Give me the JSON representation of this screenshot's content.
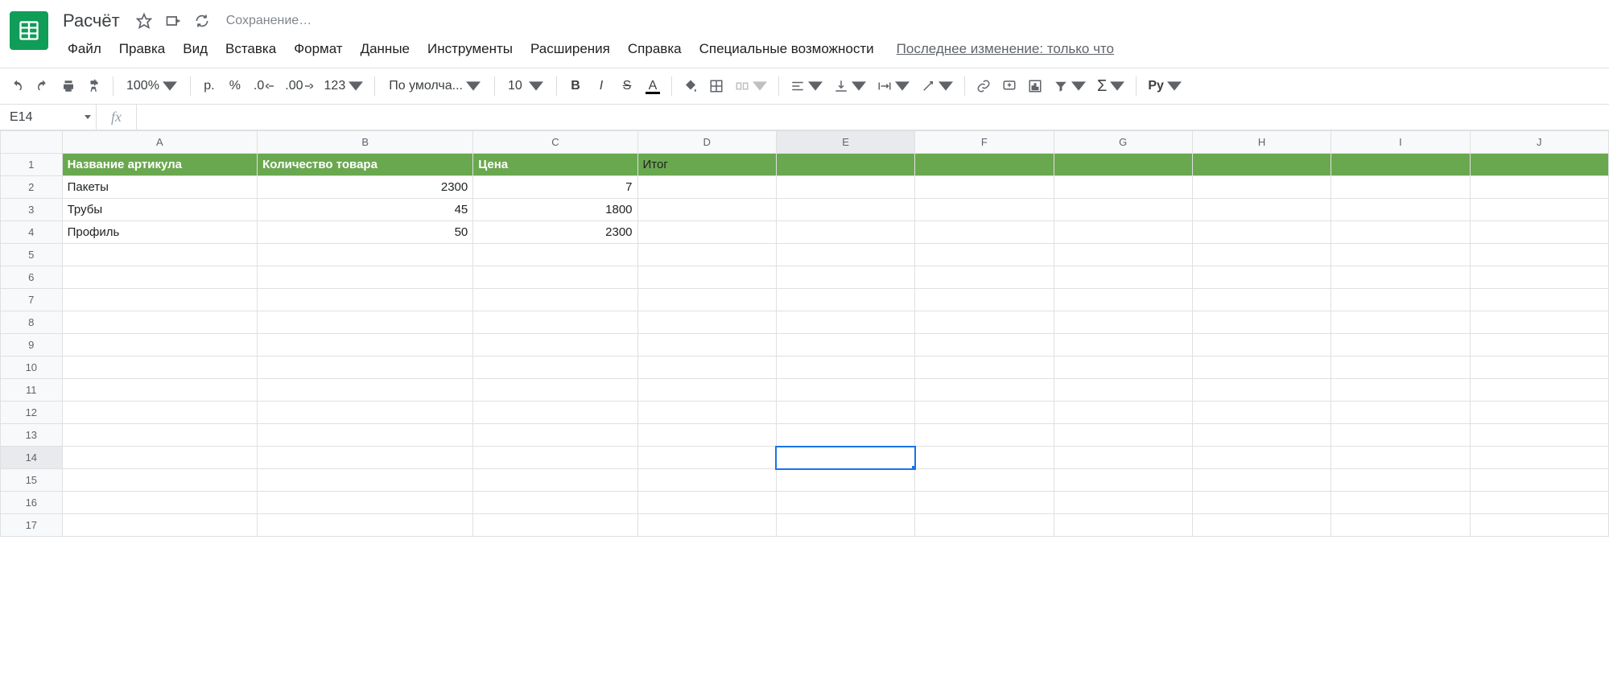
{
  "doc": {
    "title": "Расчёт",
    "saving": "Сохранение…"
  },
  "menu": {
    "file": "Файл",
    "edit": "Правка",
    "view": "Вид",
    "insert": "Вставка",
    "format": "Формат",
    "data": "Данные",
    "tools": "Инструменты",
    "extensions": "Расширения",
    "help": "Справка",
    "accessibility": "Специальные возможности",
    "last_edit": "Последнее изменение: только что"
  },
  "toolbar": {
    "zoom": "100%",
    "currency": "р.",
    "percent": "%",
    "dec_dec": ".0",
    "inc_dec": ".00",
    "more_formats": "123",
    "font": "По умолча...",
    "font_size": "10",
    "py": "Py"
  },
  "fx": {
    "namebox": "E14",
    "formula": ""
  },
  "grid": {
    "columns": [
      "A",
      "B",
      "C",
      "D",
      "E",
      "F",
      "G",
      "H",
      "I",
      "J"
    ],
    "selected_cell": "E14",
    "header_row": [
      "Название артикула",
      "Количество товара",
      "Цена",
      "Итог",
      "",
      "",
      "",
      "",
      "",
      ""
    ],
    "data": [
      {
        "a": "Пакеты",
        "b": "2300",
        "c": "7"
      },
      {
        "a": "Трубы",
        "b": "45",
        "c": "1800"
      },
      {
        "a": "Профиль",
        "b": "50",
        "c": "2300"
      }
    ]
  }
}
